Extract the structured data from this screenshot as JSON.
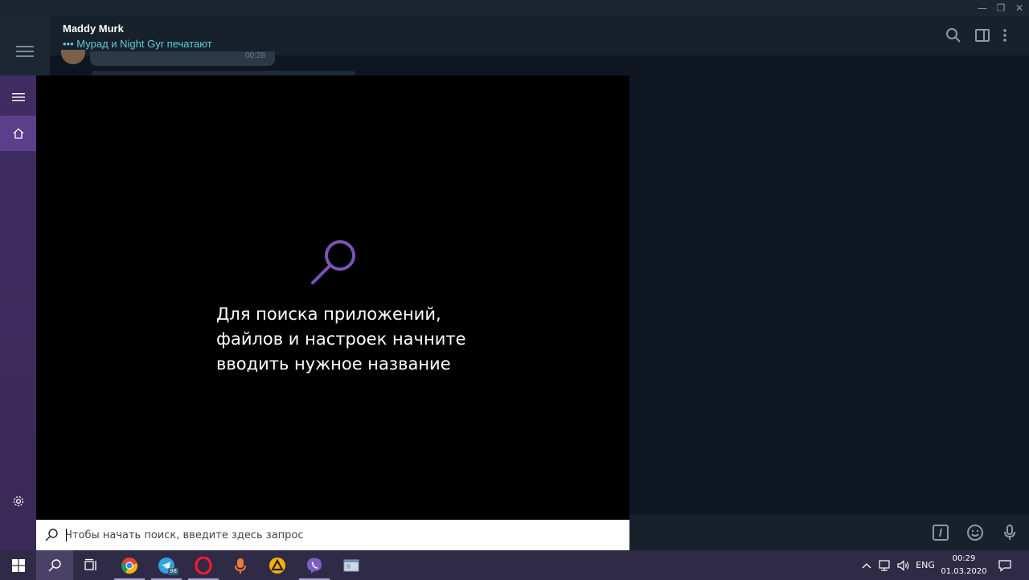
{
  "telegram": {
    "window_controls": {
      "minimize": "—",
      "restore": "❐",
      "close": "✕"
    },
    "chat": {
      "name": "Maddy Murk",
      "status_dots": "•••",
      "status": "Мурад и Night Gyr печатают",
      "last_msg_time": "00:28"
    }
  },
  "start": {
    "hint_lines": [
      "Для поиска приложений,",
      "файлов и настроек начните",
      "вводить нужное название"
    ],
    "search_placeholder": "Чтобы начать поиск, введите здесь запрос",
    "accent": "#7b55b5"
  },
  "taskbar": {
    "telegram_badge": "98",
    "language": "ENG",
    "time": "00:29",
    "date": "01.03.2020"
  }
}
